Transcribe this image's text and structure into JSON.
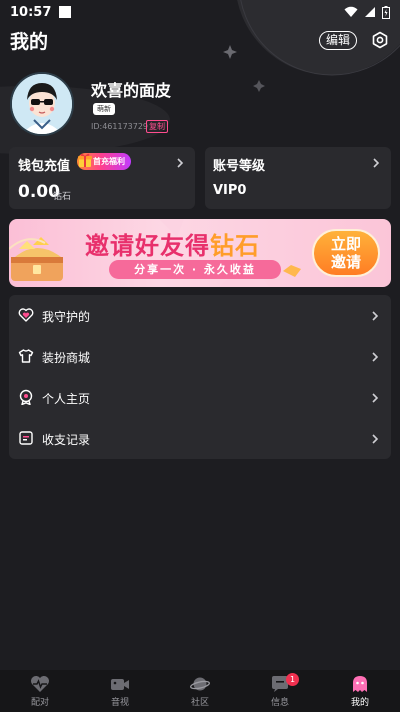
{
  "status_bar": {
    "time": "10:57"
  },
  "header": {
    "title": "我的",
    "edit_label": "编辑"
  },
  "profile": {
    "name": "欢喜的面皮",
    "tag": "萌新",
    "uid": "ID:461173729",
    "copy_label": "复制"
  },
  "wallet": {
    "title": "钱包充值",
    "promo": "首充福利",
    "balance": "0.00",
    "unit": "钻石"
  },
  "level": {
    "title": "账号等级",
    "value": "VIP0"
  },
  "banner": {
    "title_main": "邀请好友得",
    "title_accent": "钻石",
    "subtitle": "分享一次 · 永久收益",
    "button_line1": "立即",
    "button_line2": "邀请"
  },
  "menu": {
    "items": [
      {
        "label": "我守护的",
        "icon": "heart-icon"
      },
      {
        "label": "装扮商城",
        "icon": "tshirt-icon"
      },
      {
        "label": "个人主页",
        "icon": "profile-badge-icon"
      },
      {
        "label": "收支记录",
        "icon": "record-icon"
      }
    ]
  },
  "tabbar": {
    "tabs": [
      {
        "label": "配对",
        "icon": "pulse-heart-icon"
      },
      {
        "label": "音视",
        "icon": "video-camera-icon"
      },
      {
        "label": "社区",
        "icon": "planet-icon"
      },
      {
        "label": "信息",
        "icon": "chat-icon",
        "badge": "1"
      },
      {
        "label": "我的",
        "icon": "ghost-icon",
        "active": true
      }
    ]
  },
  "colors": {
    "accent_pink": "#ff4d8f",
    "card_bg": "#2a2a2e",
    "page_bg": "#1d1d21"
  }
}
